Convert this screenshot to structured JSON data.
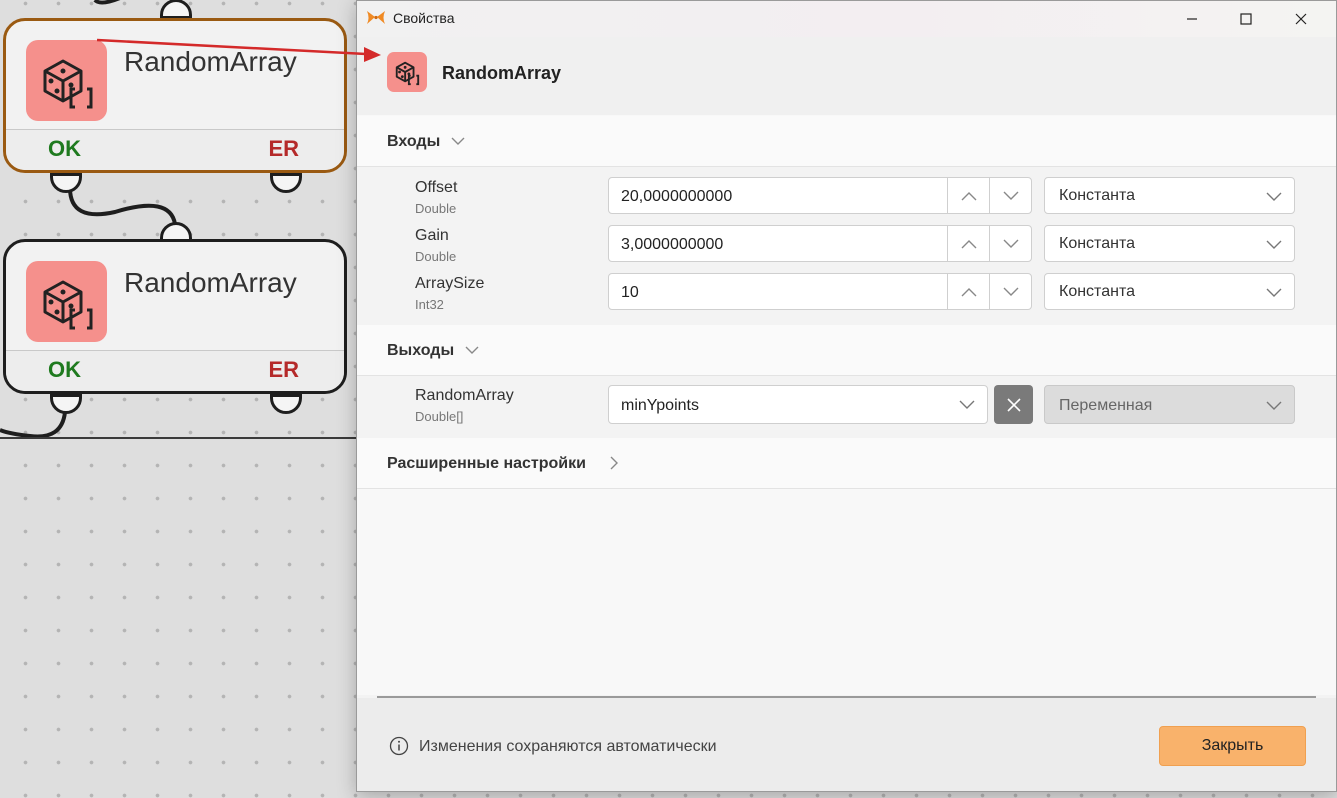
{
  "canvas": {
    "nodes": [
      {
        "title": "RandomArray",
        "ok_label": "OK",
        "er_label": "ER",
        "selected": true
      },
      {
        "title": "RandomArray",
        "ok_label": "OK",
        "er_label": "ER",
        "selected": false
      }
    ]
  },
  "dialog": {
    "window_title": "Свойства",
    "header_title": "RandomArray",
    "inputs_section": {
      "label": "Входы",
      "params": [
        {
          "name": "Offset",
          "type": "Double",
          "value": "20,0000000000",
          "mode": "Константа"
        },
        {
          "name": "Gain",
          "type": "Double",
          "value": "3,0000000000",
          "mode": "Константа"
        },
        {
          "name": "ArraySize",
          "type": "Int32",
          "value": "10",
          "mode": "Константа"
        }
      ]
    },
    "outputs_section": {
      "label": "Выходы",
      "params": [
        {
          "name": "RandomArray",
          "type": "Double[]",
          "value": "minYpoints",
          "mode": "Переменная"
        }
      ]
    },
    "advanced_section": {
      "label": "Расширенные настройки"
    },
    "footer": {
      "info_text": "Изменения сохраняются автоматически",
      "close_label": "Закрыть"
    }
  },
  "colors": {
    "accent_button": "#f9b26b",
    "node_icon_bg": "#f5908c",
    "ok_green": "#1f7a1f",
    "er_red": "#b52a2a",
    "selected_border": "#9a5a12",
    "arrow_red": "#d42a2a"
  }
}
